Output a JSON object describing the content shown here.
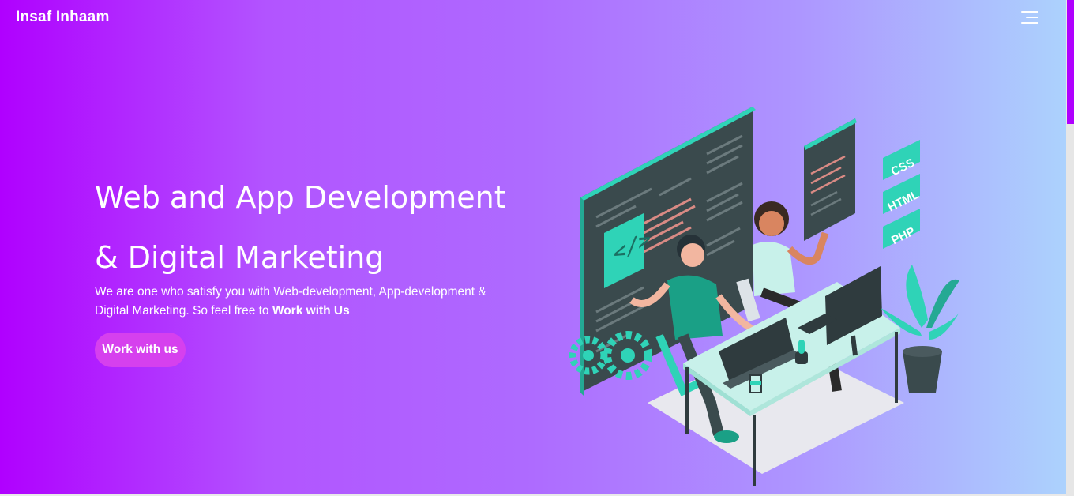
{
  "brand": "Insaf Inhaam",
  "hero": {
    "title_line1": "Web and App Development",
    "title_line2": "& Digital Marketing",
    "description": "We are one who satisfy you with Web-development, App-development & Digital Marketing. So feel free to ",
    "description_strong": "Work with Us",
    "cta_label": "Work with us"
  },
  "illustration": {
    "tags": [
      "CSS",
      "HTML",
      "PHP"
    ],
    "code_icon": "</>"
  },
  "colors": {
    "primary": "#b000ff",
    "accent": "#2fd3b7",
    "cta": "#d640ee"
  },
  "icons": {
    "menu": "hamburger-menu-icon"
  }
}
